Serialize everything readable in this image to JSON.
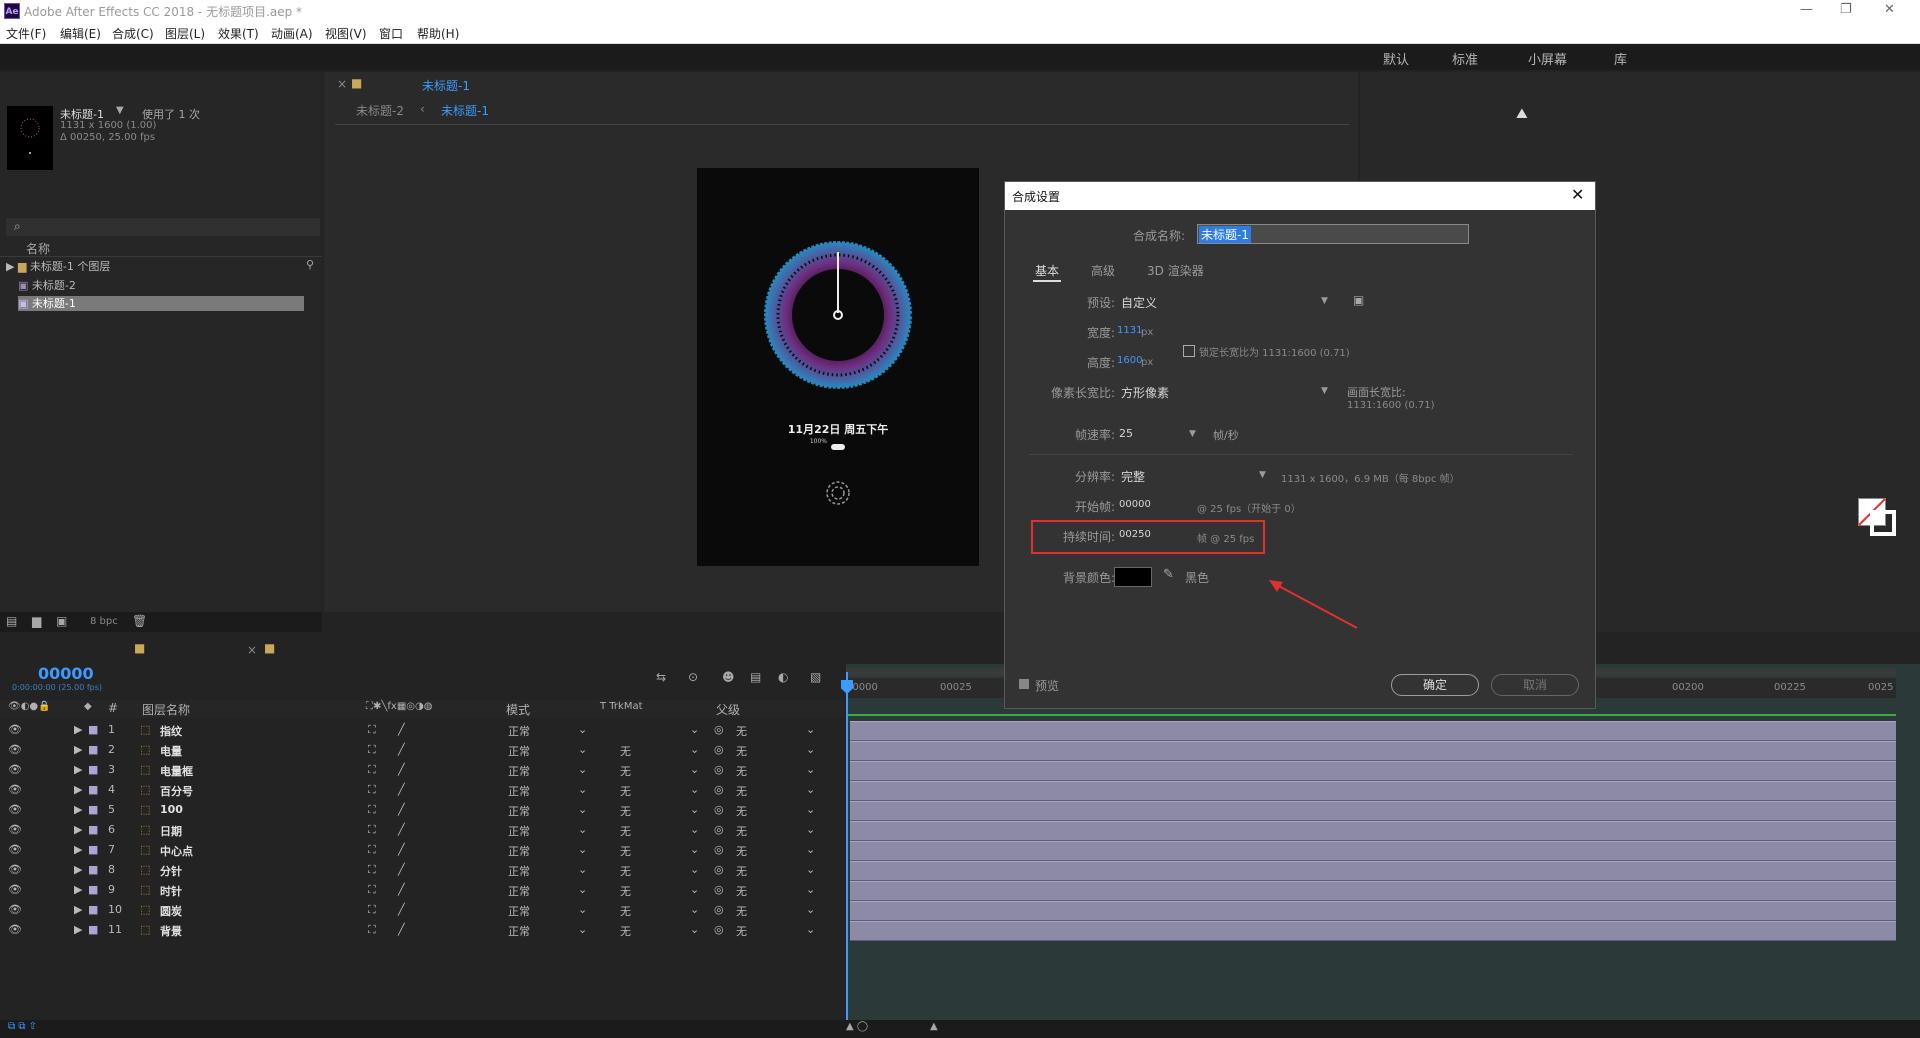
{
  "app": {
    "title": "Adobe After Effects CC 2018 - 无标题项目.aep *",
    "logo": "Ae",
    "window_controls": [
      "—",
      "❐",
      "✕"
    ]
  },
  "menu": [
    "文件(F)",
    "编辑(E)",
    "合成(C)",
    "图层(L)",
    "效果(T)",
    "动画(A)",
    "视图(V)",
    "窗口",
    "帮助(H)"
  ],
  "workspaces": [
    "默认",
    "标准",
    "小屏幕",
    "库"
  ],
  "project": {
    "thumb_name": "未标题-1",
    "used_text": "使用了 1 次",
    "info_size": "1131 x 1600 (1.00)",
    "info_dur": "Δ 00250, 25.00 fps",
    "col_name": "名称",
    "items": [
      {
        "name": "未标题-1 个图层",
        "icon": "folder-icon"
      },
      {
        "name": "未标题-2",
        "icon": "composition-icon"
      },
      {
        "name": "未标题-1",
        "icon": "composition-icon"
      }
    ],
    "bpc": "8 bpc"
  },
  "composition": {
    "tab_active": "未标题-1",
    "breadcrumb_prev": "未标题-2",
    "breadcrumb_current": "未标题-1",
    "preview_date": "11月22日 周五下午",
    "preview_battery": "100%"
  },
  "dialog": {
    "title": "合成设置",
    "name_label": "合成名称:",
    "name_value": "未标题-1",
    "tabs": [
      "基本",
      "高级",
      "3D 渲染器"
    ],
    "preset_label": "预设:",
    "preset_value": "自定义",
    "width_label": "宽度:",
    "width_value": "1131",
    "height_label": "高度:",
    "height_value": "1600",
    "unit": "px",
    "lock_label": "锁定长宽比为 1131:1600 (0.71)",
    "pixel_aspect_label": "像素长宽比:",
    "pixel_aspect_value": "方形像素",
    "frame_aspect_label": "画面长宽比:",
    "frame_aspect_value": "1131:1600 (0.71)",
    "fps_label": "帧速率:",
    "fps_value": "25",
    "fps_unit": "帧/秒",
    "resolution_label": "分辨率:",
    "resolution_value": "完整",
    "resolution_info": "1131 x 1600，6.9 MB（每 8bpc 帧）",
    "start_label": "开始帧:",
    "start_value": "00000",
    "start_info": "@ 25 fps（开始于 0）",
    "duration_label": "持续时间:",
    "duration_value": "00250",
    "duration_info": "帧 @ 25 fps",
    "bg_label": "背景颜色:",
    "bg_value": "黑色",
    "preview_label": "预览",
    "ok": "确定",
    "cancel": "取消",
    "highlight_color": "#e03030"
  },
  "timeline": {
    "timecode": "00000",
    "timecode_sub": "0:00:00:00 (25.00 fps)",
    "headers": {
      "name": "图层名称",
      "mode": "模式",
      "trkmat": "T  TrkMat",
      "parent": "父级",
      "num": "#"
    },
    "ruler": [
      "00000",
      "00025",
      "00200",
      "00225",
      "0025"
    ],
    "layers": [
      {
        "num": "1",
        "name": "指纹",
        "mode": "正常",
        "trk": "",
        "parent": "无"
      },
      {
        "num": "2",
        "name": "电量",
        "mode": "正常",
        "trk": "无",
        "parent": "无"
      },
      {
        "num": "3",
        "name": "电量框",
        "mode": "正常",
        "trk": "无",
        "parent": "无"
      },
      {
        "num": "4",
        "name": "百分号",
        "mode": "正常",
        "trk": "无",
        "parent": "无"
      },
      {
        "num": "5",
        "name": "100",
        "mode": "正常",
        "trk": "无",
        "parent": "无"
      },
      {
        "num": "6",
        "name": "日期",
        "mode": "正常",
        "trk": "无",
        "parent": "无"
      },
      {
        "num": "7",
        "name": "中心点",
        "mode": "正常",
        "trk": "无",
        "parent": "无"
      },
      {
        "num": "8",
        "name": "分针",
        "mode": "正常",
        "trk": "无",
        "parent": "无"
      },
      {
        "num": "9",
        "name": "时针",
        "mode": "正常",
        "trk": "无",
        "parent": "无"
      },
      {
        "num": "10",
        "name": "圆炭",
        "mode": "正常",
        "trk": "无",
        "parent": "无"
      },
      {
        "num": "11",
        "name": "背景",
        "mode": "正常",
        "trk": "无",
        "parent": "无"
      }
    ]
  }
}
